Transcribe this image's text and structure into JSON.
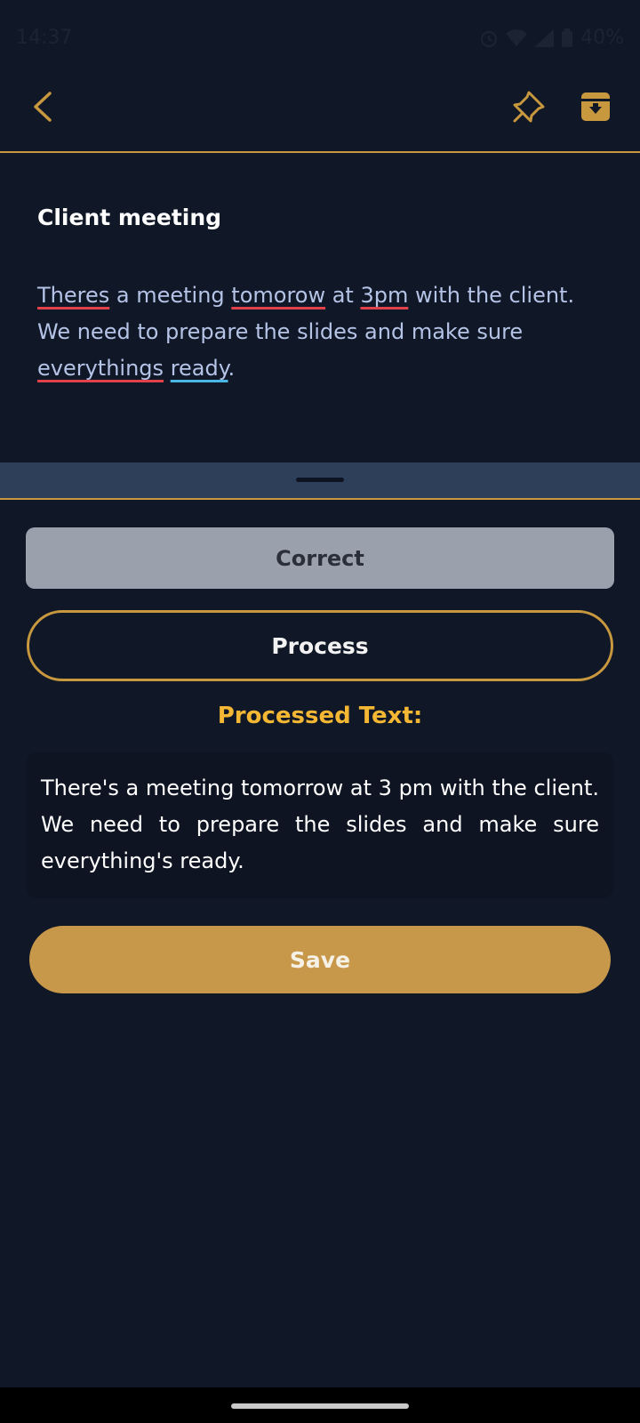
{
  "status_bar": {
    "time": "14:37",
    "battery": "40%"
  },
  "app_bar": {
    "back_icon": "chevron-left-icon",
    "pin_icon": "pin-icon",
    "archive_icon": "archive-icon"
  },
  "note": {
    "title": "Client meeting",
    "body_parts": [
      "Theres",
      " a meeting ",
      "tomorow",
      " at ",
      "3pm",
      " with the client. We need to prepare the slides and make sure ",
      "everythings",
      " ",
      "ready",
      "."
    ]
  },
  "actions": {
    "correct_label": "Correct",
    "process_label": "Process",
    "save_label": "Save"
  },
  "processed": {
    "label": "Processed Text:",
    "text": "There's a meeting tomorrow at 3 pm with the client. We need to prepare the slides and make sure everything's ready."
  },
  "colors": {
    "background": "#101727",
    "accent": "#c8983f",
    "processed_label": "#f3b733",
    "spell_error": "#e0414b",
    "grammar_hint": "#49b6e6"
  }
}
